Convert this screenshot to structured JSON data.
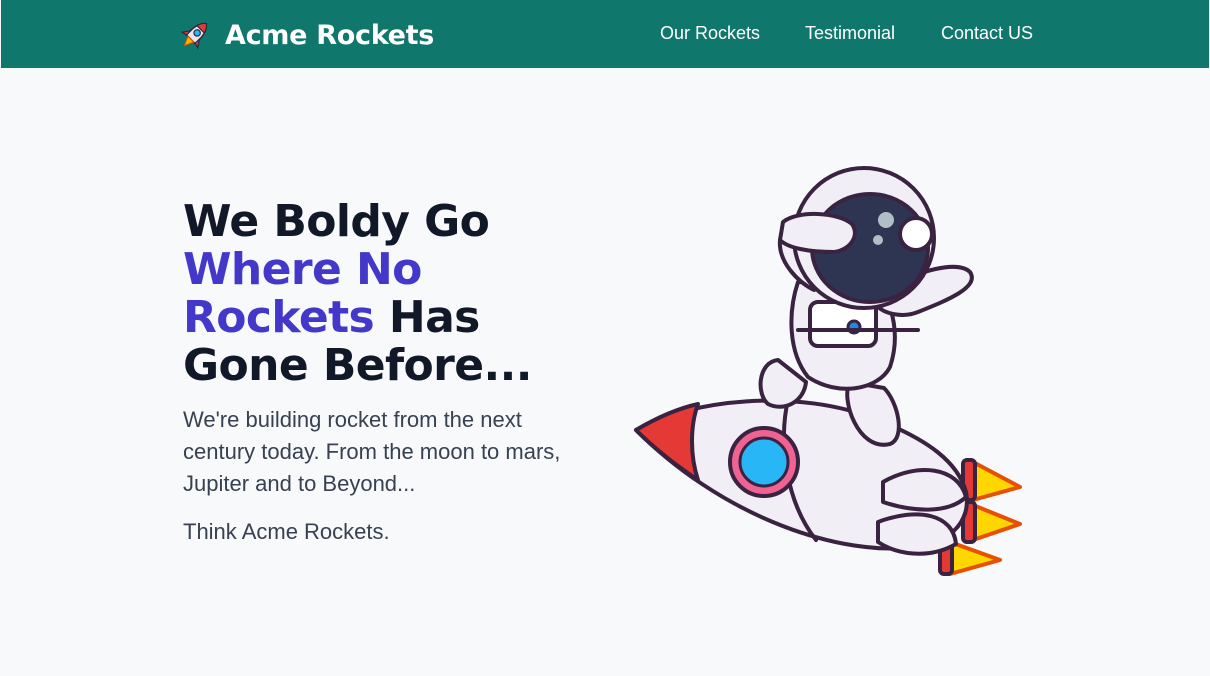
{
  "navbar": {
    "brand": {
      "name": "Acme Rockets",
      "icon": "rocket-icon"
    },
    "links": [
      {
        "label": "Our Rockets"
      },
      {
        "label": "Testimonial"
      },
      {
        "label": "Contact US"
      }
    ]
  },
  "hero": {
    "headline": {
      "part1": "We Boldy Go",
      "accent": "Where No Rockets",
      "part2": "Has Gone Before..."
    },
    "lead": "We're building rocket from the next century today. From the moon to mars, Jupiter and to Beyond...",
    "tagline": "Think Acme Rockets.",
    "illustration": "astronaut-riding-rocket"
  },
  "colors": {
    "navbar_bg": "#10776d",
    "page_bg": "#f8f9fb",
    "accent": "#4338ca",
    "heading": "#111827",
    "body_text": "#374151"
  }
}
